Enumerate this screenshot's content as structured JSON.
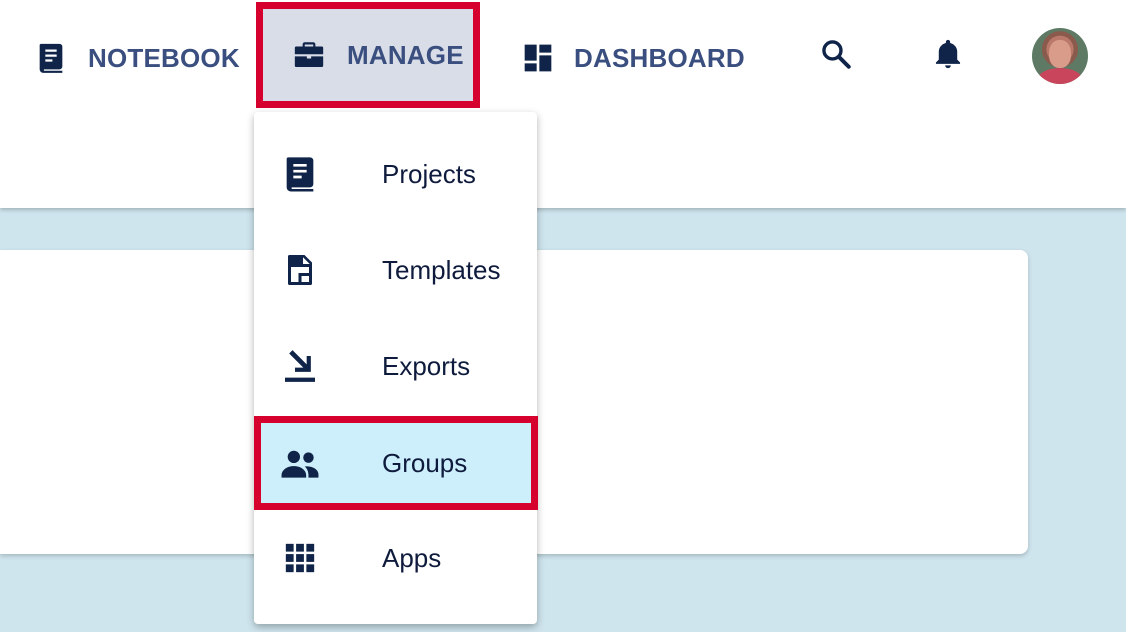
{
  "nav": {
    "notebook": {
      "label": "NOTEBOOK",
      "icon": "book-icon"
    },
    "manage": {
      "label": "MANAGE",
      "icon": "briefcase-icon"
    },
    "dashboard": {
      "label": "DASHBOARD",
      "icon": "dashboard-icon"
    },
    "search": {
      "icon": "search-icon"
    },
    "notifications": {
      "icon": "bell-icon"
    },
    "avatar": {
      "icon": "user-avatar"
    }
  },
  "manage_menu": {
    "items": [
      {
        "label": "Projects",
        "icon": "book-icon"
      },
      {
        "label": "Templates",
        "icon": "template-icon"
      },
      {
        "label": "Exports",
        "icon": "export-icon"
      },
      {
        "label": "Groups",
        "icon": "groups-icon"
      },
      {
        "label": "Apps",
        "icon": "apps-grid-icon"
      }
    ]
  },
  "colors": {
    "nav_text": "#3a4f7f",
    "icon_dark": "#0f2448",
    "highlight_border": "#d6002f",
    "manage_active_bg": "#d8dde7",
    "groups_active_bg": "#cdeefb",
    "content_bg": "#cfe5ee"
  }
}
